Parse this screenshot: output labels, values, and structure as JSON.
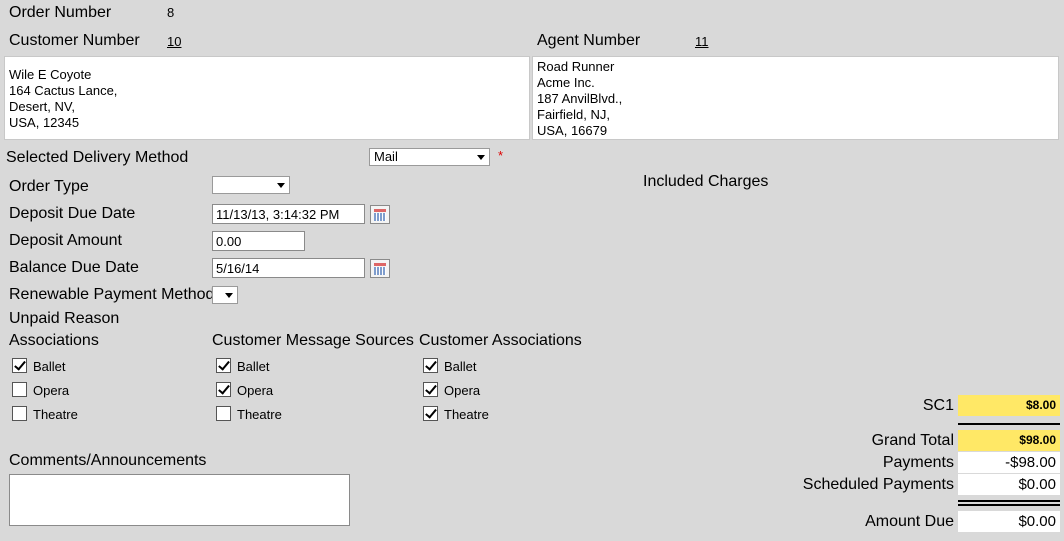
{
  "order": {
    "label": "Order Number",
    "value": "8"
  },
  "customer": {
    "label": "Customer Number",
    "value": "10",
    "address": [
      "Wile E Coyote",
      "164 Cactus Lance,",
      "Desert, NV,",
      "USA, 12345"
    ]
  },
  "agent": {
    "label": "Agent Number",
    "value": "11",
    "address": [
      "Road Runner",
      "Acme Inc.",
      "187 AnvilBlvd.,",
      "Fairfield, NJ,",
      "USA, 16679"
    ]
  },
  "delivery": {
    "label": "Selected Delivery Method",
    "value": "Mail",
    "required_mark": "*"
  },
  "order_type": {
    "label": "Order Type",
    "value": ""
  },
  "included_charges_label": "Included Charges",
  "deposit_due": {
    "label": "Deposit Due Date",
    "value": "11/13/13, 3:14:32 PM"
  },
  "deposit_amount": {
    "label": "Deposit Amount",
    "value": "0.00"
  },
  "balance_due": {
    "label": "Balance Due Date",
    "value": "5/16/14"
  },
  "renewable_payment": {
    "label": "Renewable Payment Method",
    "value": ""
  },
  "unpaid_reason_label": "Unpaid Reason",
  "groups": [
    {
      "title": "Associations",
      "items": [
        {
          "label": "Ballet",
          "checked": true
        },
        {
          "label": "Opera",
          "checked": false
        },
        {
          "label": "Theatre",
          "checked": false
        }
      ]
    },
    {
      "title": "Customer Message Sources",
      "items": [
        {
          "label": "Ballet",
          "checked": true
        },
        {
          "label": "Opera",
          "checked": true
        },
        {
          "label": "Theatre",
          "checked": false
        }
      ]
    },
    {
      "title": "Customer Associations",
      "items": [
        {
          "label": "Ballet",
          "checked": true
        },
        {
          "label": "Opera",
          "checked": true
        },
        {
          "label": "Theatre",
          "checked": true
        }
      ]
    }
  ],
  "comments_label": "Comments/Announcements",
  "totals": {
    "sc1": {
      "label": "SC1",
      "value": "$8.00"
    },
    "grand_total": {
      "label": "Grand Total",
      "value": "$98.00"
    },
    "payments": {
      "label": "Payments",
      "value": "-$98.00"
    },
    "scheduled_payments": {
      "label": "Scheduled Payments",
      "value": "$0.00"
    },
    "amount_due": {
      "label": "Amount Due",
      "value": "$0.00"
    }
  },
  "colors": {
    "background": "#d9d9d9",
    "highlight": "#ffe866",
    "required": "#dd0000"
  },
  "icons": {
    "date_picker": "calendar-icon"
  }
}
